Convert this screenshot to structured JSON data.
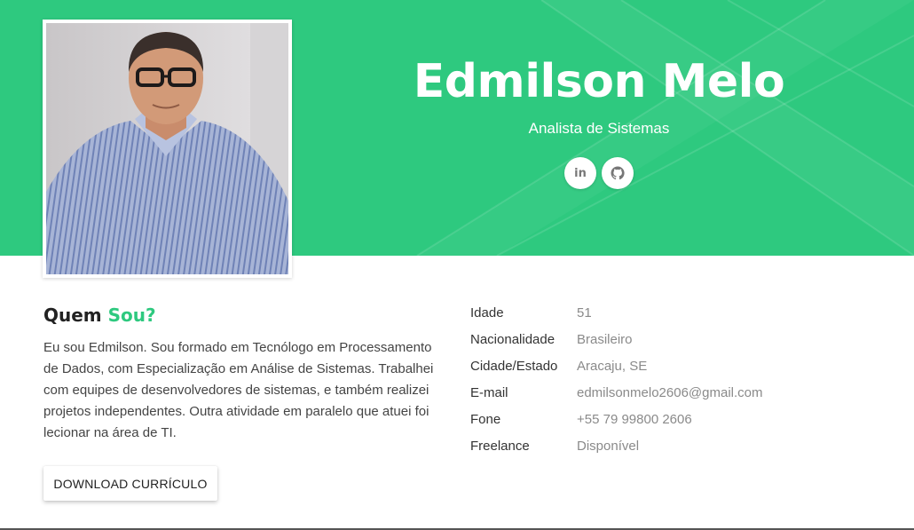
{
  "colors": {
    "accent": "#2ec97f",
    "hero_bg": "#2ec97f",
    "text_dark": "#222222",
    "text_muted": "#8a8a8a"
  },
  "hero": {
    "name": "Edmilson Melo",
    "role": "Analista de Sistemas",
    "socials": [
      {
        "icon": "linkedin-icon",
        "glyph": "in"
      },
      {
        "icon": "github-icon",
        "glyph": "gh"
      }
    ]
  },
  "about": {
    "title_prefix": "Quem",
    "title_accent": "Sou?",
    "text": "Eu sou Edmilson. Sou formado em Tecnólogo em Processamento de Dados, com Especialização em Análise de Sistemas. Trabalhei com equipes de desenvolvedores de sistemas, e também realizei projetos independentes. Outra atividade em paralelo que atuei foi lecionar na área de TI.",
    "button_label": "DOWNLOAD CURRÍCULO"
  },
  "info": [
    {
      "label": "Idade",
      "value": "51"
    },
    {
      "label": "Nacionalidade",
      "value": "Brasileiro"
    },
    {
      "label": "Cidade/Estado",
      "value": "Aracaju, SE"
    },
    {
      "label": "E-mail",
      "value": "edmilsonmelo2606@gmail.com"
    },
    {
      "label": "Fone",
      "value": "+55 79 99800 2606"
    },
    {
      "label": "Freelance",
      "value": "Disponível"
    }
  ]
}
